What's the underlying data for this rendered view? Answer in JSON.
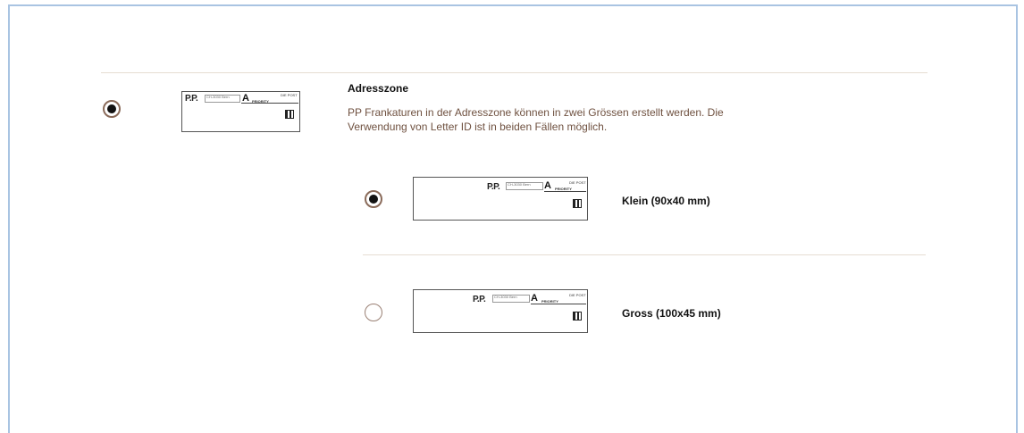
{
  "zone": {
    "title": "Adresszone",
    "description": "PP Frankaturen in der Adresszone können in zwei Grössen erstellt werden. Die Verwendung von Letter ID ist in beiden Fällen möglich.",
    "selected": true
  },
  "stamp": {
    "pp": "P.P.",
    "box_text": "CH-3030 Bern",
    "a": "A",
    "a_small": "PRIORITY",
    "logo": "DIE POST"
  },
  "options": [
    {
      "label": "Klein (90x40 mm)",
      "selected": true
    },
    {
      "label": "Gross (100x45 mm)",
      "selected": false
    }
  ]
}
